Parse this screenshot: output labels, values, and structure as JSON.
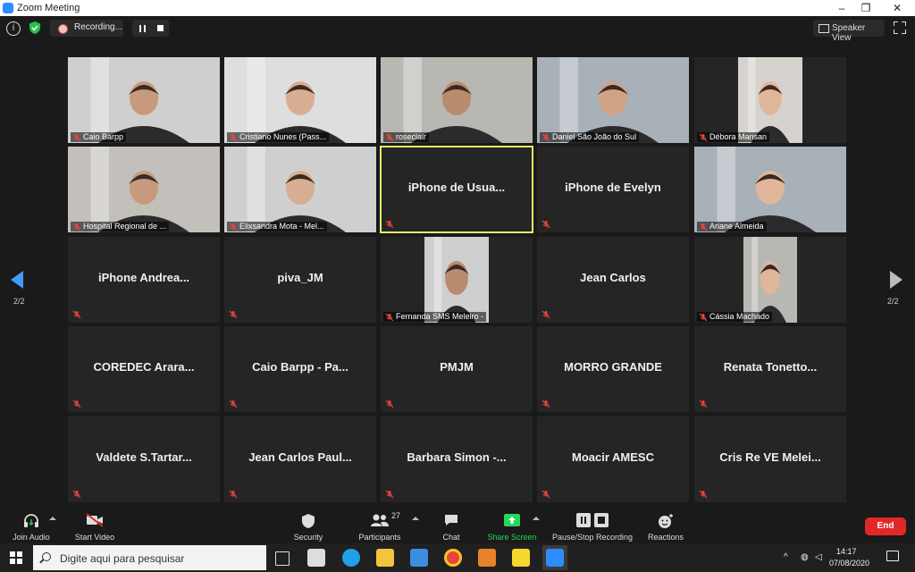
{
  "window": {
    "title": "Zoom Meeting",
    "controls": [
      "–",
      "❐",
      "✕"
    ]
  },
  "top_bar": {
    "recording_label": "Recording...",
    "speaker_view_label": "Speaker View"
  },
  "pagination": {
    "left_page": "2/2",
    "right_page": "2/2"
  },
  "participants": [
    {
      "label": "Caio Barpp",
      "video": true
    },
    {
      "label": "Cristiano Nunes (Pass...",
      "video": true
    },
    {
      "label": "roseclair",
      "video": true
    },
    {
      "label": "Daniel São João do Sul",
      "video": true
    },
    {
      "label": "Débora Mansan",
      "video": true
    },
    {
      "label": "Hospital Regional de ...",
      "video": true
    },
    {
      "label": "Elixsandra Mota - Mel...",
      "video": true
    },
    {
      "name": "iPhone de Usua...",
      "video": false,
      "active": true
    },
    {
      "name": "iPhone de Evelyn",
      "video": false
    },
    {
      "label": "Ariane Almeida",
      "video": true
    },
    {
      "name": "iPhone Andrea...",
      "video": false
    },
    {
      "name": "piva_JM",
      "video": false
    },
    {
      "label": "Fernanda SMS Meleiro -",
      "video": true
    },
    {
      "name": "Jean Carlos",
      "video": false
    },
    {
      "label": "Cássia Machado",
      "video": true
    },
    {
      "name": "COREDEC Arara...",
      "video": false
    },
    {
      "name": "Caio Barpp - Pa...",
      "video": false
    },
    {
      "name": "PMJM",
      "video": false
    },
    {
      "name": "MORRO GRANDE",
      "video": false
    },
    {
      "name": "Renata Tonetto...",
      "video": false
    },
    {
      "name": "Valdete S.Tartar...",
      "video": false
    },
    {
      "name": "Jean Carlos Paul...",
      "video": false
    },
    {
      "name": "Barbara Simon -...",
      "video": false
    },
    {
      "name": "Moacir AMESC",
      "video": false
    },
    {
      "name": "Cris Re VE Melei...",
      "video": false
    }
  ],
  "toolbar": {
    "join_audio": "Join Audio",
    "start_video": "Start Video",
    "security": "Security",
    "participants": "Participants",
    "participants_count": "27",
    "chat": "Chat",
    "share_screen": "Share Screen",
    "pause_stop_recording": "Pause/Stop Recording",
    "reactions": "Reactions",
    "end": "End"
  },
  "taskbar": {
    "search_placeholder": "Digite aqui para pesquisar",
    "time": "14:17",
    "date": "07/08/2020"
  },
  "colors": {
    "accent": "#2d8cff",
    "active_speaker": "#e6ec6a",
    "end": "#e02828",
    "share": "#23d959"
  }
}
